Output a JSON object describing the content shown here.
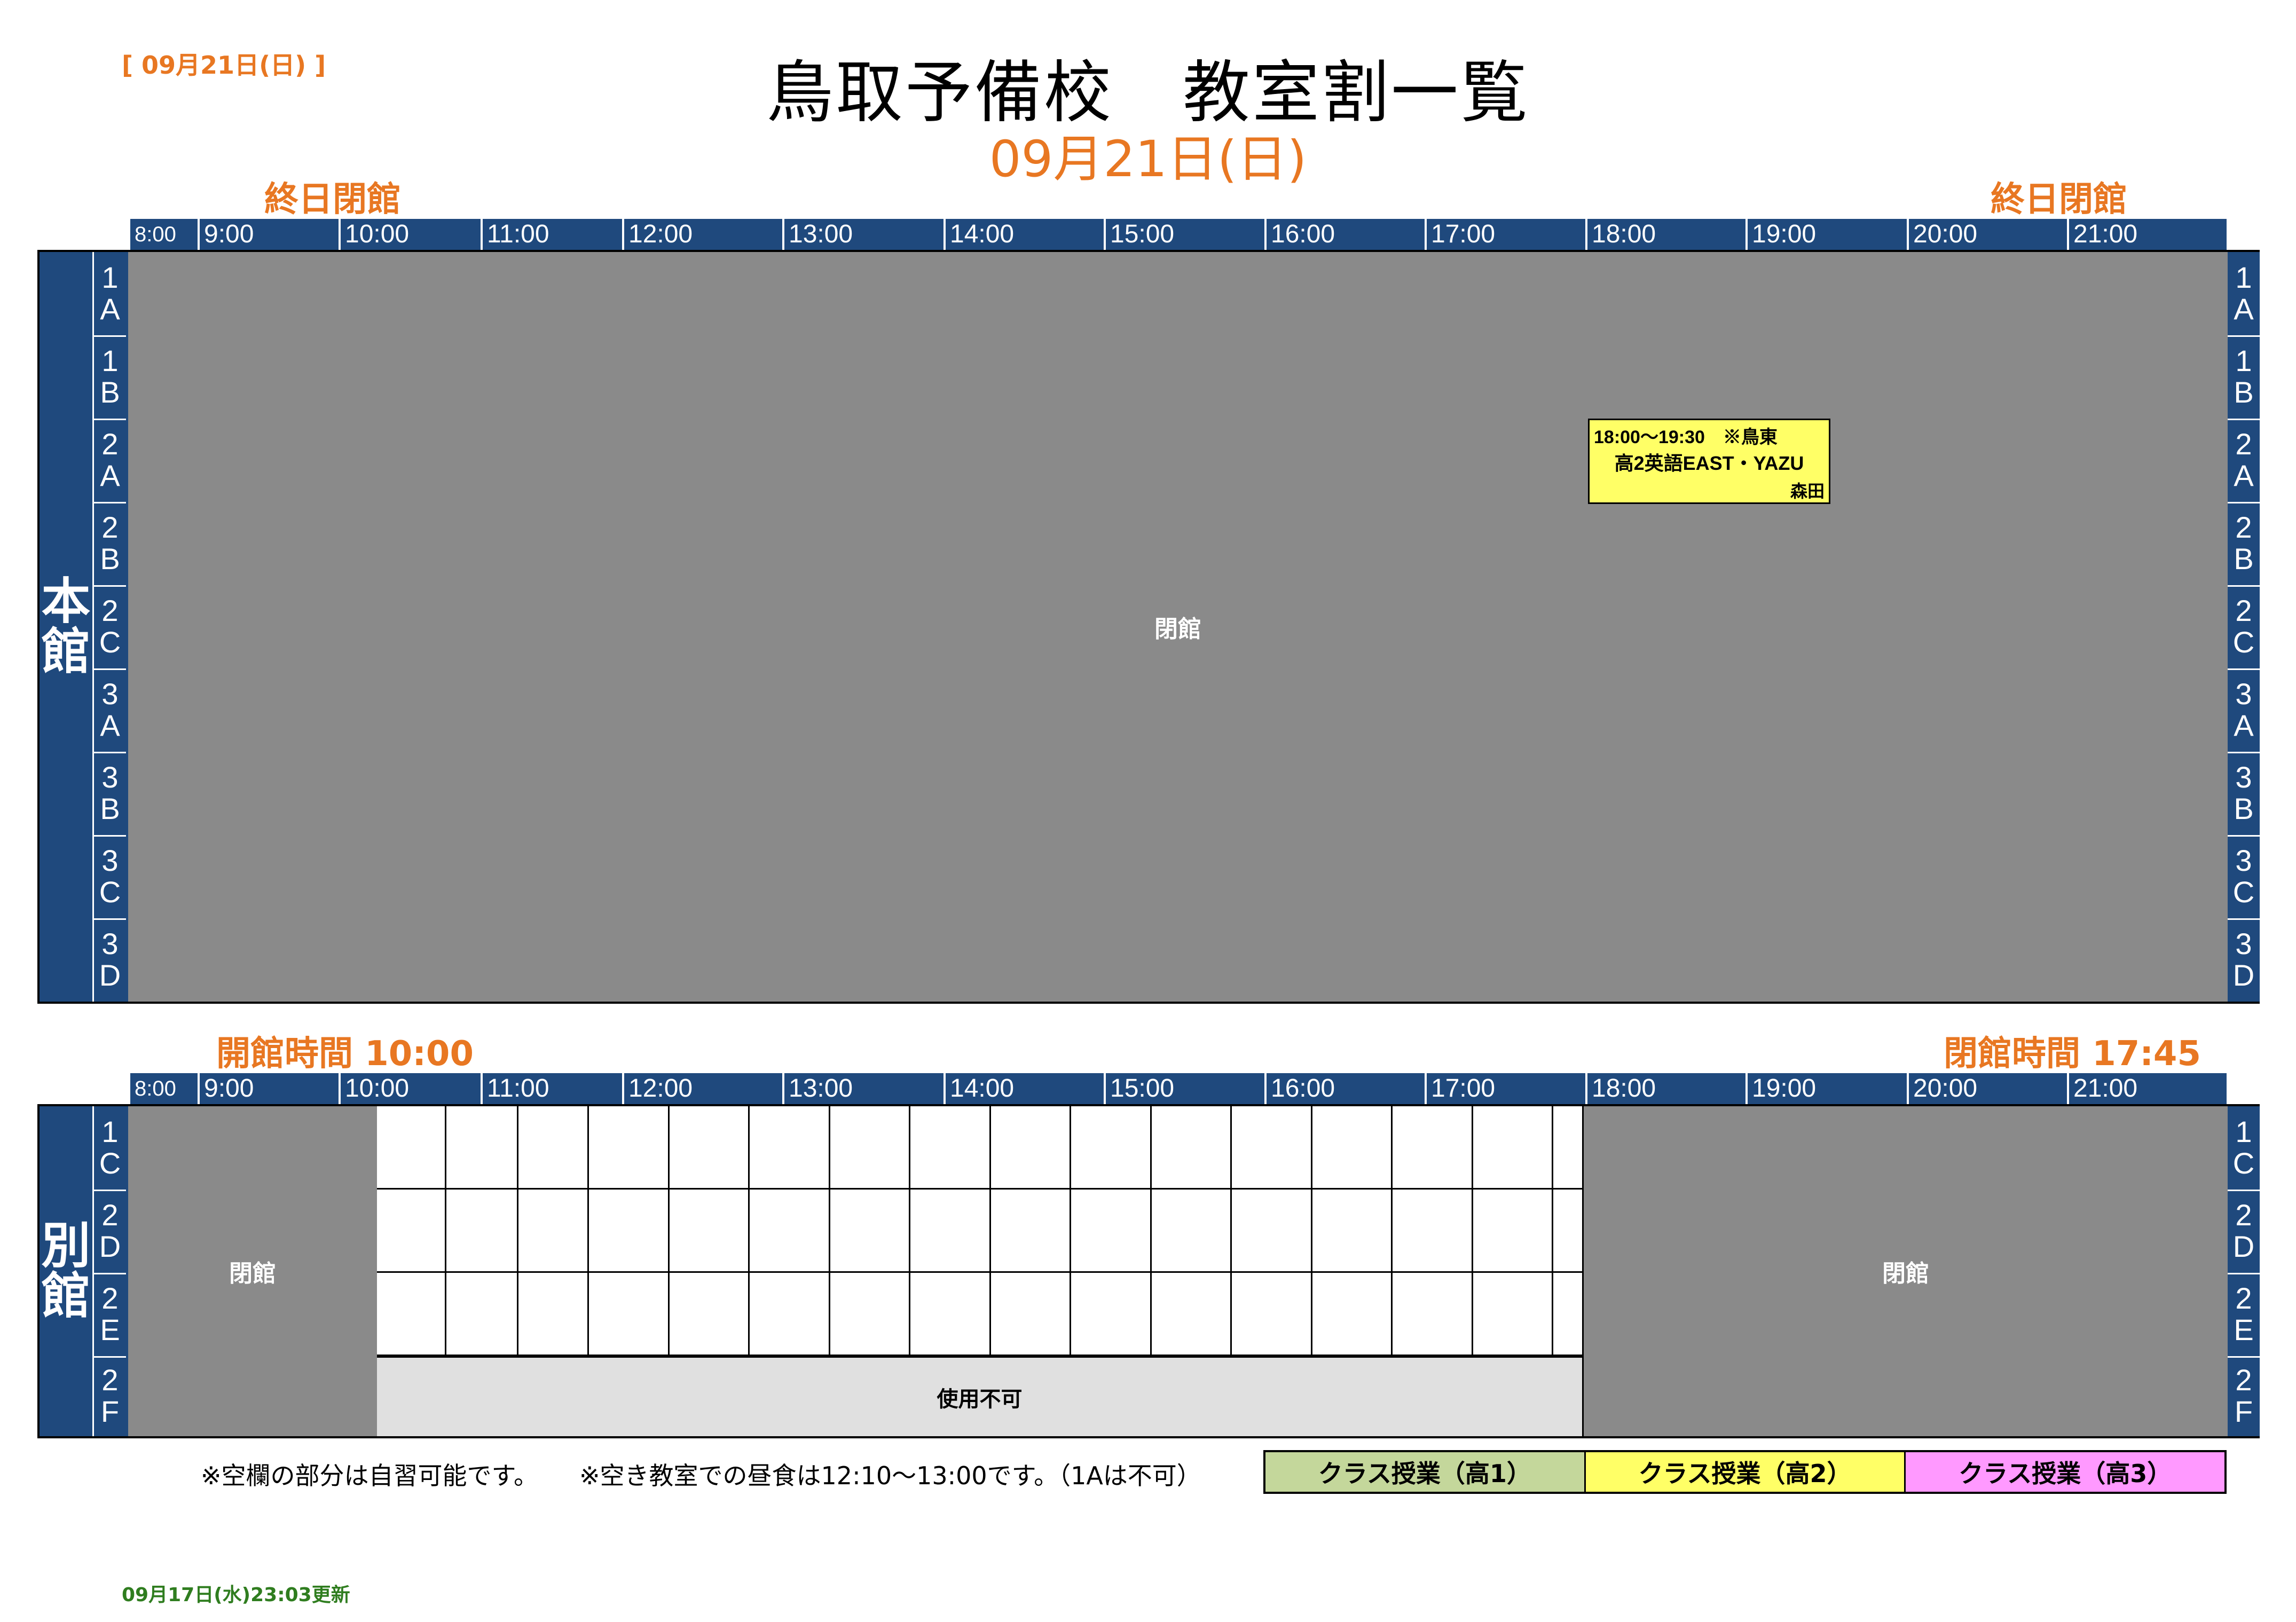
{
  "header": {
    "date_tag": "[ 09月21日(日) ]",
    "title": "鳥取予備校　教室割一覧",
    "subtitle": "09月21日(日)"
  },
  "time_labels": [
    "8:00",
    "9:00",
    "10:00",
    "11:00",
    "12:00",
    "13:00",
    "14:00",
    "15:00",
    "16:00",
    "17:00",
    "18:00",
    "19:00",
    "20:00",
    "21:00"
  ],
  "honkan": {
    "name_chars": [
      "本",
      "館"
    ],
    "notice_left": "終日閉館",
    "notice_right": "終日閉館",
    "rooms": [
      [
        "1",
        "A"
      ],
      [
        "1",
        "B"
      ],
      [
        "2",
        "A"
      ],
      [
        "2",
        "B"
      ],
      [
        "2",
        "C"
      ],
      [
        "3",
        "A"
      ],
      [
        "3",
        "B"
      ],
      [
        "3",
        "C"
      ],
      [
        "3",
        "D"
      ]
    ],
    "closed_label": "閉館",
    "event": {
      "time": "18:00～19:30　※鳥東",
      "name": "高2英語EAST・YAZU",
      "teacher": "森田",
      "color": "#ffff66"
    }
  },
  "bekkan": {
    "name_chars": [
      "別",
      "館"
    ],
    "notice_left": "開館時間 10:00",
    "notice_right": "閉館時間 17:45",
    "rooms": [
      [
        "1",
        "C"
      ],
      [
        "2",
        "D"
      ],
      [
        "2",
        "E"
      ],
      [
        "2",
        "F"
      ]
    ],
    "closed_label_left": "閉館",
    "closed_label_right": "閉館",
    "unusable_label": "使用不可"
  },
  "footnotes": {
    "note1": "※空欄の部分は自習可能です。",
    "note2": "※空き教室での昼食は12:10～13:00です。（1Aは不可）"
  },
  "legend": [
    {
      "label": "クラス授業（高1）",
      "color": "#c4d79b"
    },
    {
      "label": "クラス授業（高2）",
      "color": "#ffff66"
    },
    {
      "label": "クラス授業（高3）",
      "color": "#ff99ff"
    }
  ],
  "updated": "09月17日(水)23:03更新",
  "colors": {
    "accent": "#e87722",
    "header_blue": "#1f497d",
    "closed_gray": "#8a8a8a",
    "unusable_gray": "#e0e0e0",
    "updated_green": "#2f7d1f"
  }
}
